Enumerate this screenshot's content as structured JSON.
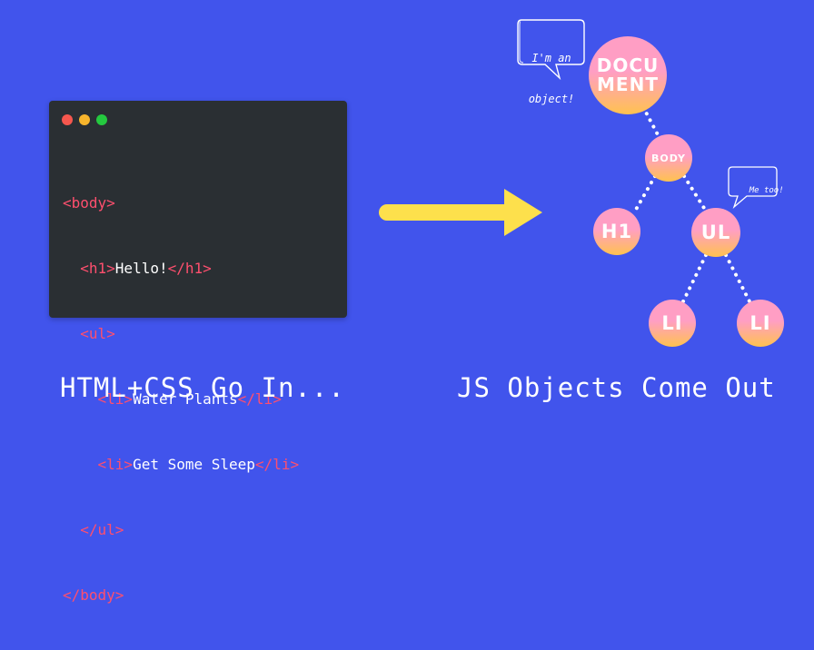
{
  "colors": {
    "background": "#4154ec",
    "code_bg": "#2a2f33",
    "tag": "#ff4f6e",
    "text": "#ffffff",
    "arrow": "#fde04c",
    "node_top": "#ff9ec4",
    "node_bottom": "#ffc24f",
    "dot_red": "#f6574e",
    "dot_yellow": "#f7b52c",
    "dot_green": "#24c93f"
  },
  "code_lines": [
    {
      "indent": "",
      "open": "<body>",
      "text": "",
      "close": ""
    },
    {
      "indent": "  ",
      "open": "<h1>",
      "text": "Hello!",
      "close": "</h1>"
    },
    {
      "indent": "  ",
      "open": "<ul>",
      "text": "",
      "close": ""
    },
    {
      "indent": "    ",
      "open": "<li>",
      "text": "Water Plants",
      "close": "</li>"
    },
    {
      "indent": "    ",
      "open": "<li>",
      "text": "Get Some Sleep",
      "close": "</li>"
    },
    {
      "indent": "  ",
      "open": "</ul>",
      "text": "",
      "close": ""
    },
    {
      "indent": "",
      "open": "</body>",
      "text": "",
      "close": ""
    }
  ],
  "nodes": {
    "document": {
      "line1": "DOCU",
      "line2": "MENT"
    },
    "body": "BODY",
    "h1": "H1",
    "ul": "UL",
    "li_left": "LI",
    "li_right": "LI"
  },
  "bubbles": {
    "document": {
      "line1": "I'm an",
      "line2": "object!"
    },
    "ul": "Me too!"
  },
  "captions": {
    "left": "HTML+CSS Go In...",
    "right": "JS Objects Come Out"
  }
}
